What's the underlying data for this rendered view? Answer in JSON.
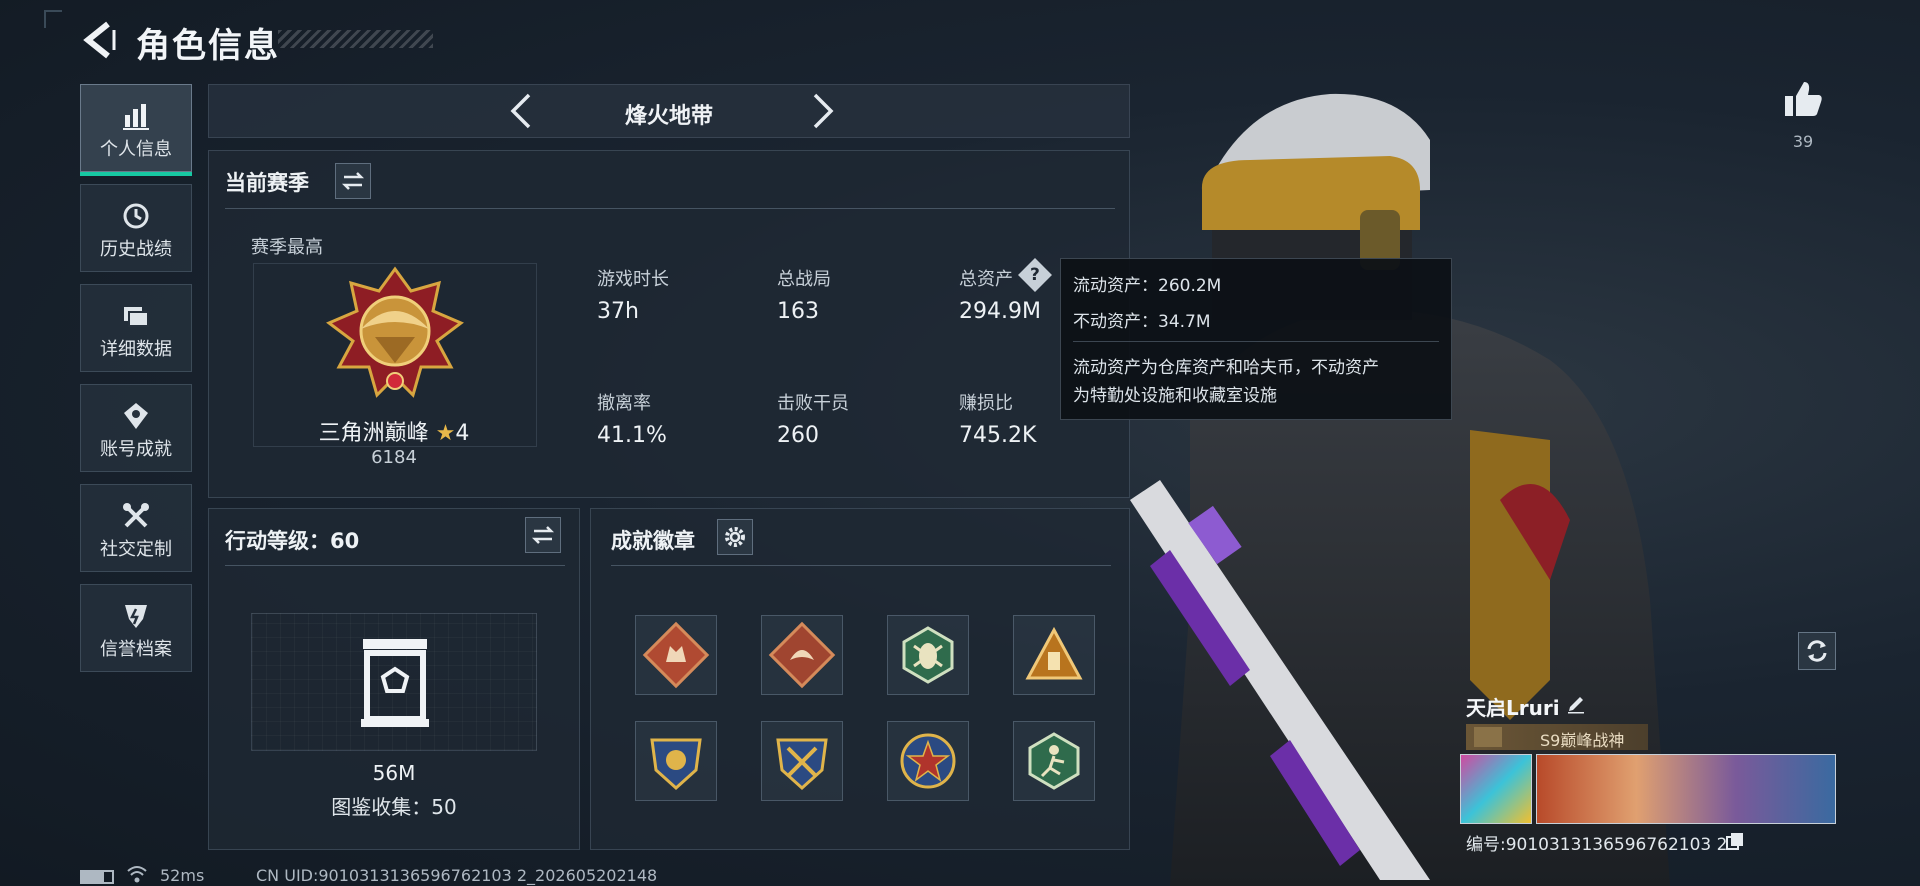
{
  "header": {
    "title": "角色信息"
  },
  "sidebar": {
    "items": [
      {
        "label": "个人信息",
        "icon": "bar-chart-icon",
        "active": true
      },
      {
        "label": "历史战绩",
        "icon": "history-icon",
        "active": false
      },
      {
        "label": "详细数据",
        "icon": "folder-icon",
        "active": false
      },
      {
        "label": "账号成就",
        "icon": "achievement-icon",
        "active": false
      },
      {
        "label": "社交定制",
        "icon": "tools-icon",
        "active": false
      },
      {
        "label": "信誉档案",
        "icon": "credit-icon",
        "active": false
      }
    ]
  },
  "mode": {
    "title": "烽火地带"
  },
  "season": {
    "title": "当前赛季",
    "best_label": "赛季最高",
    "rank_name": "三角洲巅峰",
    "rank_stars": "4",
    "rank_score": "6184",
    "stats": [
      {
        "label": "游戏时长",
        "value": "37h"
      },
      {
        "label": "总战局",
        "value": "163"
      },
      {
        "label": "总资产",
        "value": "294.9M"
      },
      {
        "label": "撤离率",
        "value": "41.1%"
      },
      {
        "label": "击败干员",
        "value": "260"
      },
      {
        "label": "赚损比",
        "value": "745.2K"
      }
    ]
  },
  "tooltip": {
    "liquid": "流动资产：260.2M",
    "fixed": "不动资产：34.7M",
    "desc_1": "流动资产为仓库资产和哈夫币，不动资产",
    "desc_2": "为特勤处设施和收藏室设施"
  },
  "level": {
    "title": "行动等级：60",
    "value": "56M",
    "collection": "图鉴收集：50"
  },
  "badges": {
    "title": "成就徽章",
    "items": [
      {
        "icon": "wolf-badge-icon",
        "color": "#b04a32"
      },
      {
        "icon": "dragon-badge-icon",
        "color": "#a04530"
      },
      {
        "icon": "bug-badge-icon",
        "color": "#2f6b4c"
      },
      {
        "icon": "triangle-badge-icon",
        "color": "#b8741e"
      },
      {
        "icon": "shield-badge-icon",
        "color": "#2b4a82"
      },
      {
        "icon": "crossed-weapons-badge-icon",
        "color": "#2b4a82"
      },
      {
        "icon": "star-badge-icon",
        "color": "#b0342c"
      },
      {
        "icon": "runner-badge-icon",
        "color": "#2f6b4c"
      }
    ]
  },
  "likes": {
    "count": "39"
  },
  "profile": {
    "name": "天启Lruri",
    "title": "S9巅峰战神",
    "uid": "编号:9010313136596762103 2"
  },
  "footer": {
    "ping": "52ms",
    "cn_uid": "CN UID:9010313136596762103 2_202605202148"
  },
  "colors": {
    "accent": "#17c9a3",
    "gold": "#d8a640",
    "panel": "#1e2833"
  }
}
